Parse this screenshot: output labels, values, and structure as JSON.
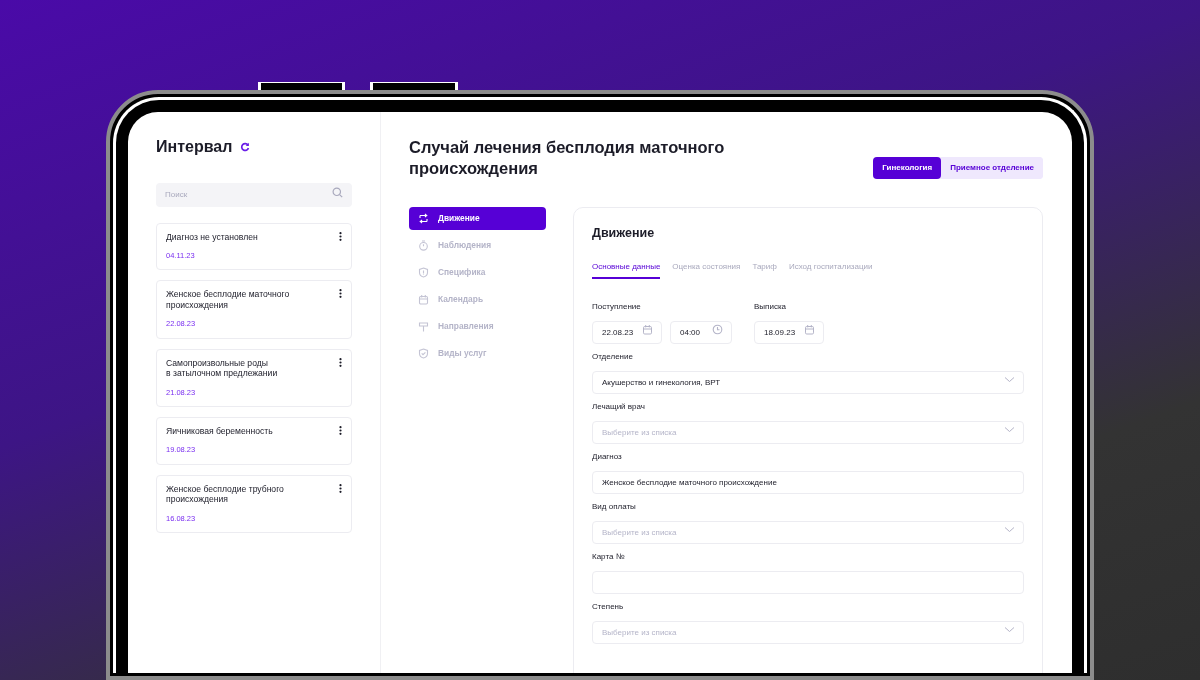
{
  "sidebar": {
    "title": "Интервал",
    "search": {
      "placeholder": "Поиск"
    },
    "cases": [
      {
        "title": "Диагноз не установлен",
        "date": "04.11.23"
      },
      {
        "title": "Женское бесплодие маточного\nпроисхождения",
        "date": "22.08.23"
      },
      {
        "title": "Самопроизвольные роды\nв затылочном предлежании",
        "date": "21.08.23"
      },
      {
        "title": "Яичниковая беременность",
        "date": "19.08.23"
      },
      {
        "title": "Женское бесплодие трубного\nпроисхождения",
        "date": "16.08.23"
      }
    ]
  },
  "header": {
    "title": "Случай лечения бесплодия маточного происхождения",
    "departments": [
      {
        "label": "Гинекология",
        "selected": true
      },
      {
        "label": "Приемное отделение",
        "selected": false
      }
    ]
  },
  "nav": [
    {
      "label": "Движение",
      "selected": true
    },
    {
      "label": "Наблюдения",
      "selected": false
    },
    {
      "label": "Специфика",
      "selected": false
    },
    {
      "label": "Календарь",
      "selected": false
    },
    {
      "label": "Направления",
      "selected": false
    },
    {
      "label": "Виды услуг",
      "selected": false
    }
  ],
  "form": {
    "title": "Движение",
    "tabs": [
      {
        "label": "Основные данные",
        "selected": true
      },
      {
        "label": "Оценка состояния",
        "selected": false
      },
      {
        "label": "Тариф",
        "selected": false
      },
      {
        "label": "Исход госпитализации",
        "selected": false
      }
    ],
    "admission": {
      "label": "Поступление",
      "date": "22.08.23",
      "time": "04:00"
    },
    "discharge": {
      "label": "Выписка",
      "date": "18.09.23"
    },
    "fields": [
      {
        "label": "Отделение",
        "kind": "select",
        "value": "Акушерство и гинекология, ВРТ"
      },
      {
        "label": "Лечащий врач",
        "kind": "select",
        "placeholder": "Выберите из списка"
      },
      {
        "label": "Диагноз",
        "kind": "text",
        "value": "Женское бесплодие маточного происхождение"
      },
      {
        "label": "Вид оплаты",
        "kind": "select",
        "placeholder": "Выберите из списка"
      },
      {
        "label": "Карта №",
        "kind": "text"
      },
      {
        "label": "Степень",
        "kind": "select",
        "placeholder": "Выберите из списка"
      }
    ]
  }
}
